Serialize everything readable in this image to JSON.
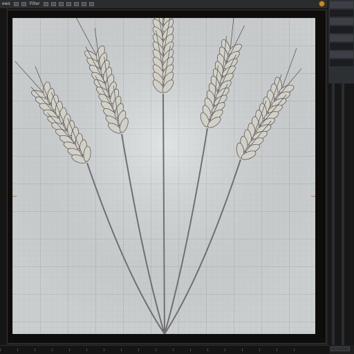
{
  "menu": {
    "items": [
      "ews",
      "Filter"
    ]
  },
  "side_panel": {
    "rows": [
      "",
      "",
      "",
      "",
      "",
      "",
      "",
      ""
    ]
  },
  "canvas": {
    "background": "#d7dbdc",
    "grid_color": "#bfc5c8",
    "stalk_color": "#6e6f70",
    "grain_color": "#d3d0c7"
  }
}
